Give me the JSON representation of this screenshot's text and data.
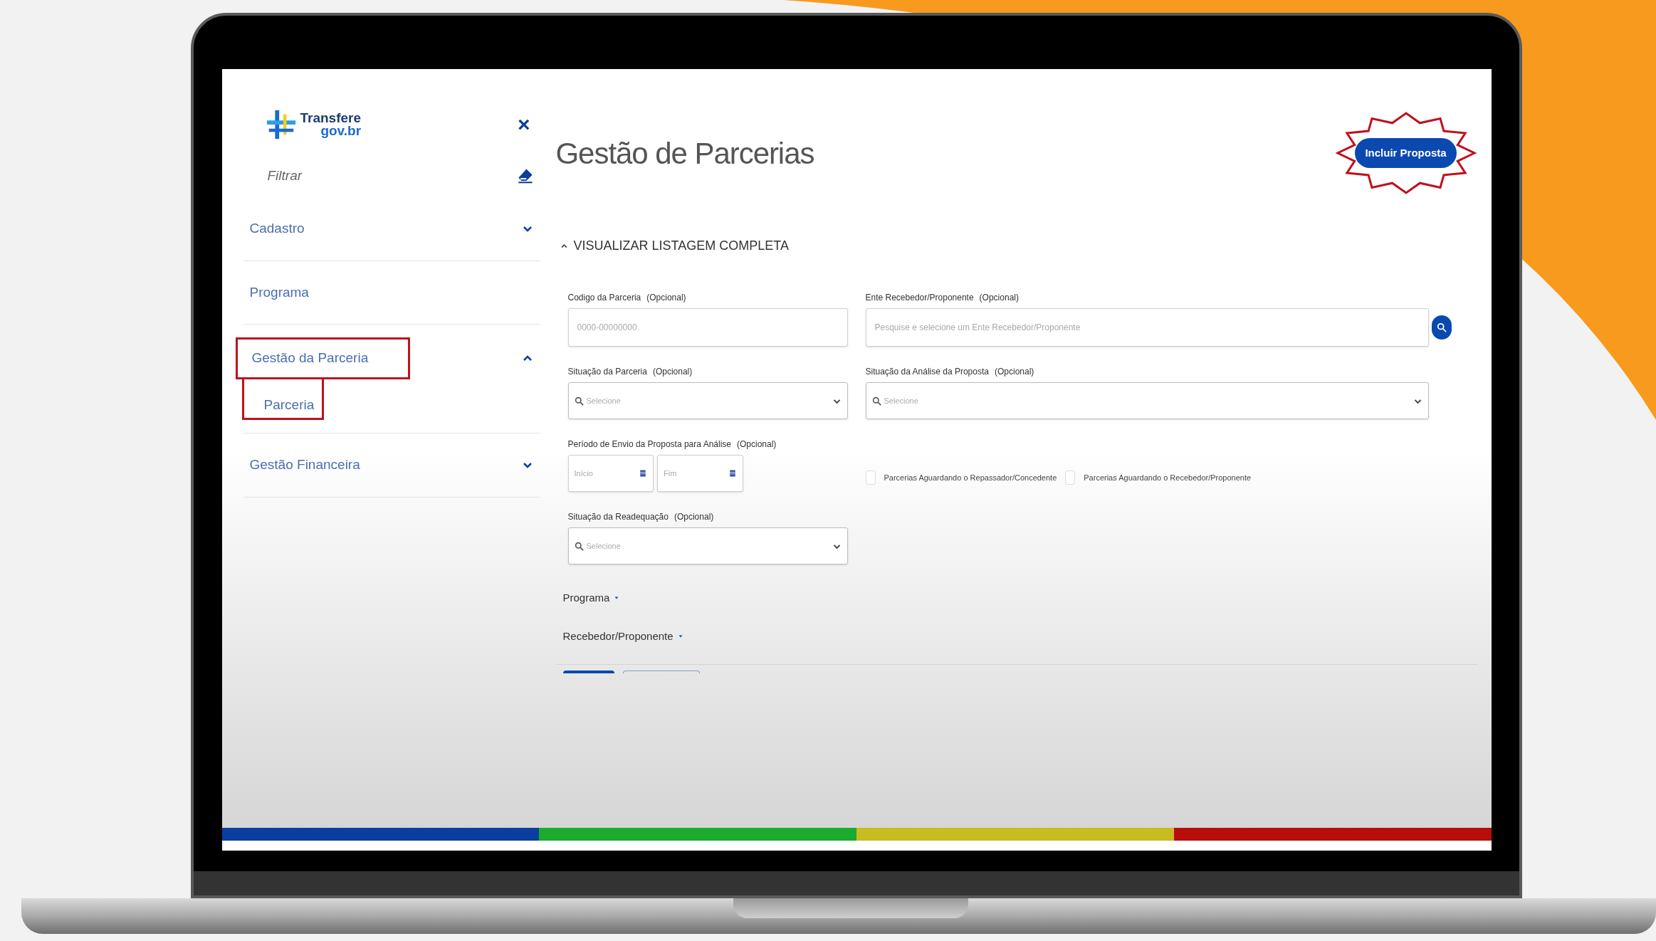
{
  "sidebar": {
    "brand": {
      "line1": "Transfere",
      "line2": "gov.br"
    },
    "close": "×",
    "filter": {
      "placeholder": "Filtrar"
    },
    "items": [
      {
        "label": "Cadastro",
        "expanded": false,
        "highlighted": false
      },
      {
        "label": "Programa",
        "highlighted": false
      },
      {
        "label": "Gestão da Parceria",
        "expanded": true,
        "highlighted": true,
        "children": [
          {
            "label": "Parceria",
            "highlighted": true
          }
        ]
      },
      {
        "label": "Gestão Financeira",
        "expanded": false,
        "highlighted": false
      }
    ]
  },
  "header": {
    "title": "Gestão de Parcerias",
    "action": {
      "label": "Incluir Proposta",
      "highlighted": true
    }
  },
  "filters": {
    "toggle": {
      "label": "VISUALIZAR LISTAGEM COMPLETA",
      "expanded": true
    },
    "code": {
      "label": "Codigo da Parceria",
      "optional": "(Opcional)",
      "placeholder": "0000-00000000"
    },
    "entity": {
      "label": "Ente Recebedor/Proponente",
      "optional": "(Opcional)",
      "placeholder": "Pesquise e selecione um Ente Recebedor/Proponente"
    },
    "status": {
      "label": "Situação da Parceria",
      "optional": "(Opcional)",
      "placeholder": "Selecione"
    },
    "analysis": {
      "label": "Situação da Análise da Proposta",
      "optional": "(Opcional)",
      "placeholder": "Selecione"
    },
    "period": {
      "label": "Período de Envio da Proposta para Análise",
      "optional": "(Opcional)",
      "start_placeholder": "Início",
      "end_placeholder": "Fim"
    },
    "checkboxes": [
      {
        "label": "Parcerias Aguardando o Repassador/Concedente",
        "checked": false
      },
      {
        "label": "Parcerias Aguardando o Recebedor/Proponente",
        "checked": false
      }
    ],
    "readjust": {
      "label": "Situação da Readequação",
      "optional": "(Opcional)",
      "placeholder": "Selecione"
    },
    "sections": [
      {
        "label": "Programa",
        "expanded": false
      },
      {
        "label": "Recebedor/Proponente",
        "expanded": false
      }
    ]
  }
}
